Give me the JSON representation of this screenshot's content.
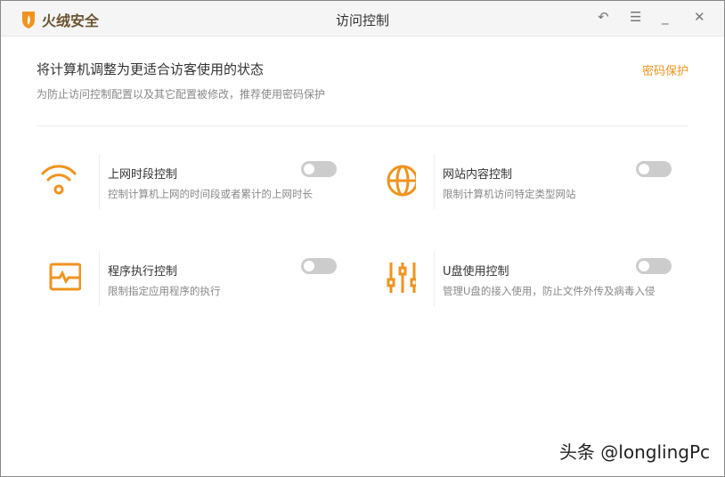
{
  "app": {
    "name": "火绒安全",
    "title": "访问控制"
  },
  "header": {
    "title": "将计算机调整为更适合访客使用的状态",
    "subtitle": "为防止访问控制配置以及其它配置被修改，推荐使用密码保护",
    "password_link": "密码保护"
  },
  "cards": [
    {
      "title": "上网时段控制",
      "desc": "控制计算机上网的时间段或者累计的上网时长",
      "icon": "wifi-icon",
      "enabled": false
    },
    {
      "title": "网站内容控制",
      "desc": "限制计算机访问特定类型网站",
      "icon": "globe-icon",
      "enabled": false
    },
    {
      "title": "程序执行控制",
      "desc": "限制指定应用程序的执行",
      "icon": "monitor-pulse-icon",
      "enabled": false
    },
    {
      "title": "U盘使用控制",
      "desc": "管理U盘的接入使用，防止文件外传及病毒入侵",
      "icon": "sliders-icon",
      "enabled": false
    }
  ],
  "watermark": "头条 @longlingPc",
  "colors": {
    "accent": "#f0931e"
  }
}
